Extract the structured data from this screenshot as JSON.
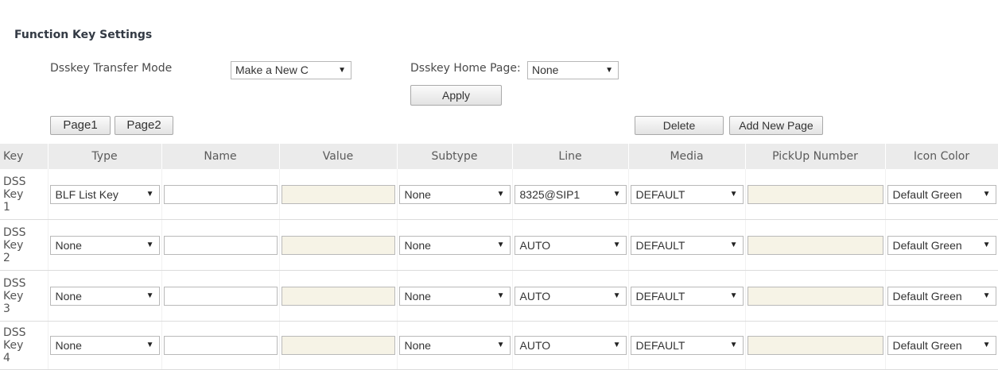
{
  "section_title": "Function Key Settings",
  "transfer_mode": {
    "label": "Dsskey Transfer Mode",
    "value": "Make a New C"
  },
  "home_page": {
    "label": "Dsskey Home Page:",
    "value": "None"
  },
  "apply_label": "Apply",
  "pages": [
    "Page1",
    "Page2"
  ],
  "delete_label": "Delete",
  "add_page_label": "Add New Page",
  "columns": [
    "Key",
    "Type",
    "Name",
    "Value",
    "Subtype",
    "Line",
    "Media",
    "PickUp Number",
    "Icon Color"
  ],
  "rows": [
    {
      "key": [
        "DSS",
        "Key",
        "1"
      ],
      "type": "BLF List Key",
      "name": "",
      "value": "",
      "subtype": "None",
      "line": "8325@SIP1",
      "media": "DEFAULT",
      "pickup": "",
      "icon_color": "Default Green"
    },
    {
      "key": [
        "DSS",
        "Key",
        "2"
      ],
      "type": "None",
      "name": "",
      "value": "",
      "subtype": "None",
      "line": "AUTO",
      "media": "DEFAULT",
      "pickup": "",
      "icon_color": "Default Green"
    },
    {
      "key": [
        "DSS",
        "Key",
        "3"
      ],
      "type": "None",
      "name": "",
      "value": "",
      "subtype": "None",
      "line": "AUTO",
      "media": "DEFAULT",
      "pickup": "",
      "icon_color": "Default Green"
    },
    {
      "key": [
        "DSS",
        "Key",
        "4"
      ],
      "type": "None",
      "name": "",
      "value": "",
      "subtype": "None",
      "line": "AUTO",
      "media": "DEFAULT",
      "pickup": "",
      "icon_color": "Default Green"
    }
  ],
  "icons": {
    "dropdown_arrow": "dropdown-arrow-icon"
  }
}
